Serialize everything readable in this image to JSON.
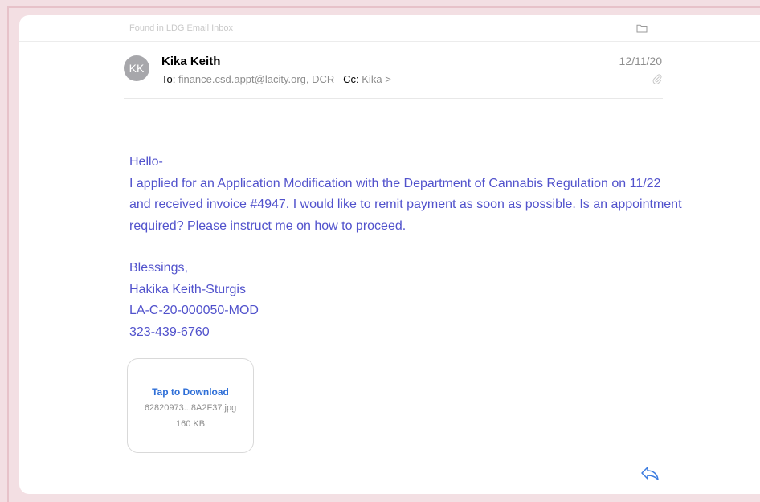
{
  "mailbox_label": "Found in LDG Email Inbox",
  "message": {
    "sender_initials": "KK",
    "sender_name": "Kika Keith",
    "to_label": "To:",
    "to_value": "finance.csd.appt@lacity.org, DCR",
    "cc_label": "Cc:",
    "cc_value": "Kika",
    "cc_chevron": ">",
    "date": "12/11/20"
  },
  "body": {
    "greeting": "Hello-",
    "paragraph": "I applied for an Application Modification with the Department of Cannabis Regulation on 11/22 and received invoice #4947. I would like to remit payment as soon as possible. Is an appointment required? Please instruct me on how to proceed.",
    "signoff": "Blessings,",
    "name": "Hakika Keith-Sturgis",
    "license": "LA-C-20-000050-MOD",
    "phone": "323-439-6760"
  },
  "attachment": {
    "action_label": "Tap to Download",
    "filename": "62820973...8A2F37.jpg",
    "size": "160 KB"
  },
  "colors": {
    "body_text": "#5152cc",
    "link_blue": "#2f6fd7",
    "background_pink": "#f3dfe3"
  },
  "icons": {
    "folder": "folder-icon",
    "attachment": "paperclip-icon",
    "reply": "reply-icon"
  }
}
